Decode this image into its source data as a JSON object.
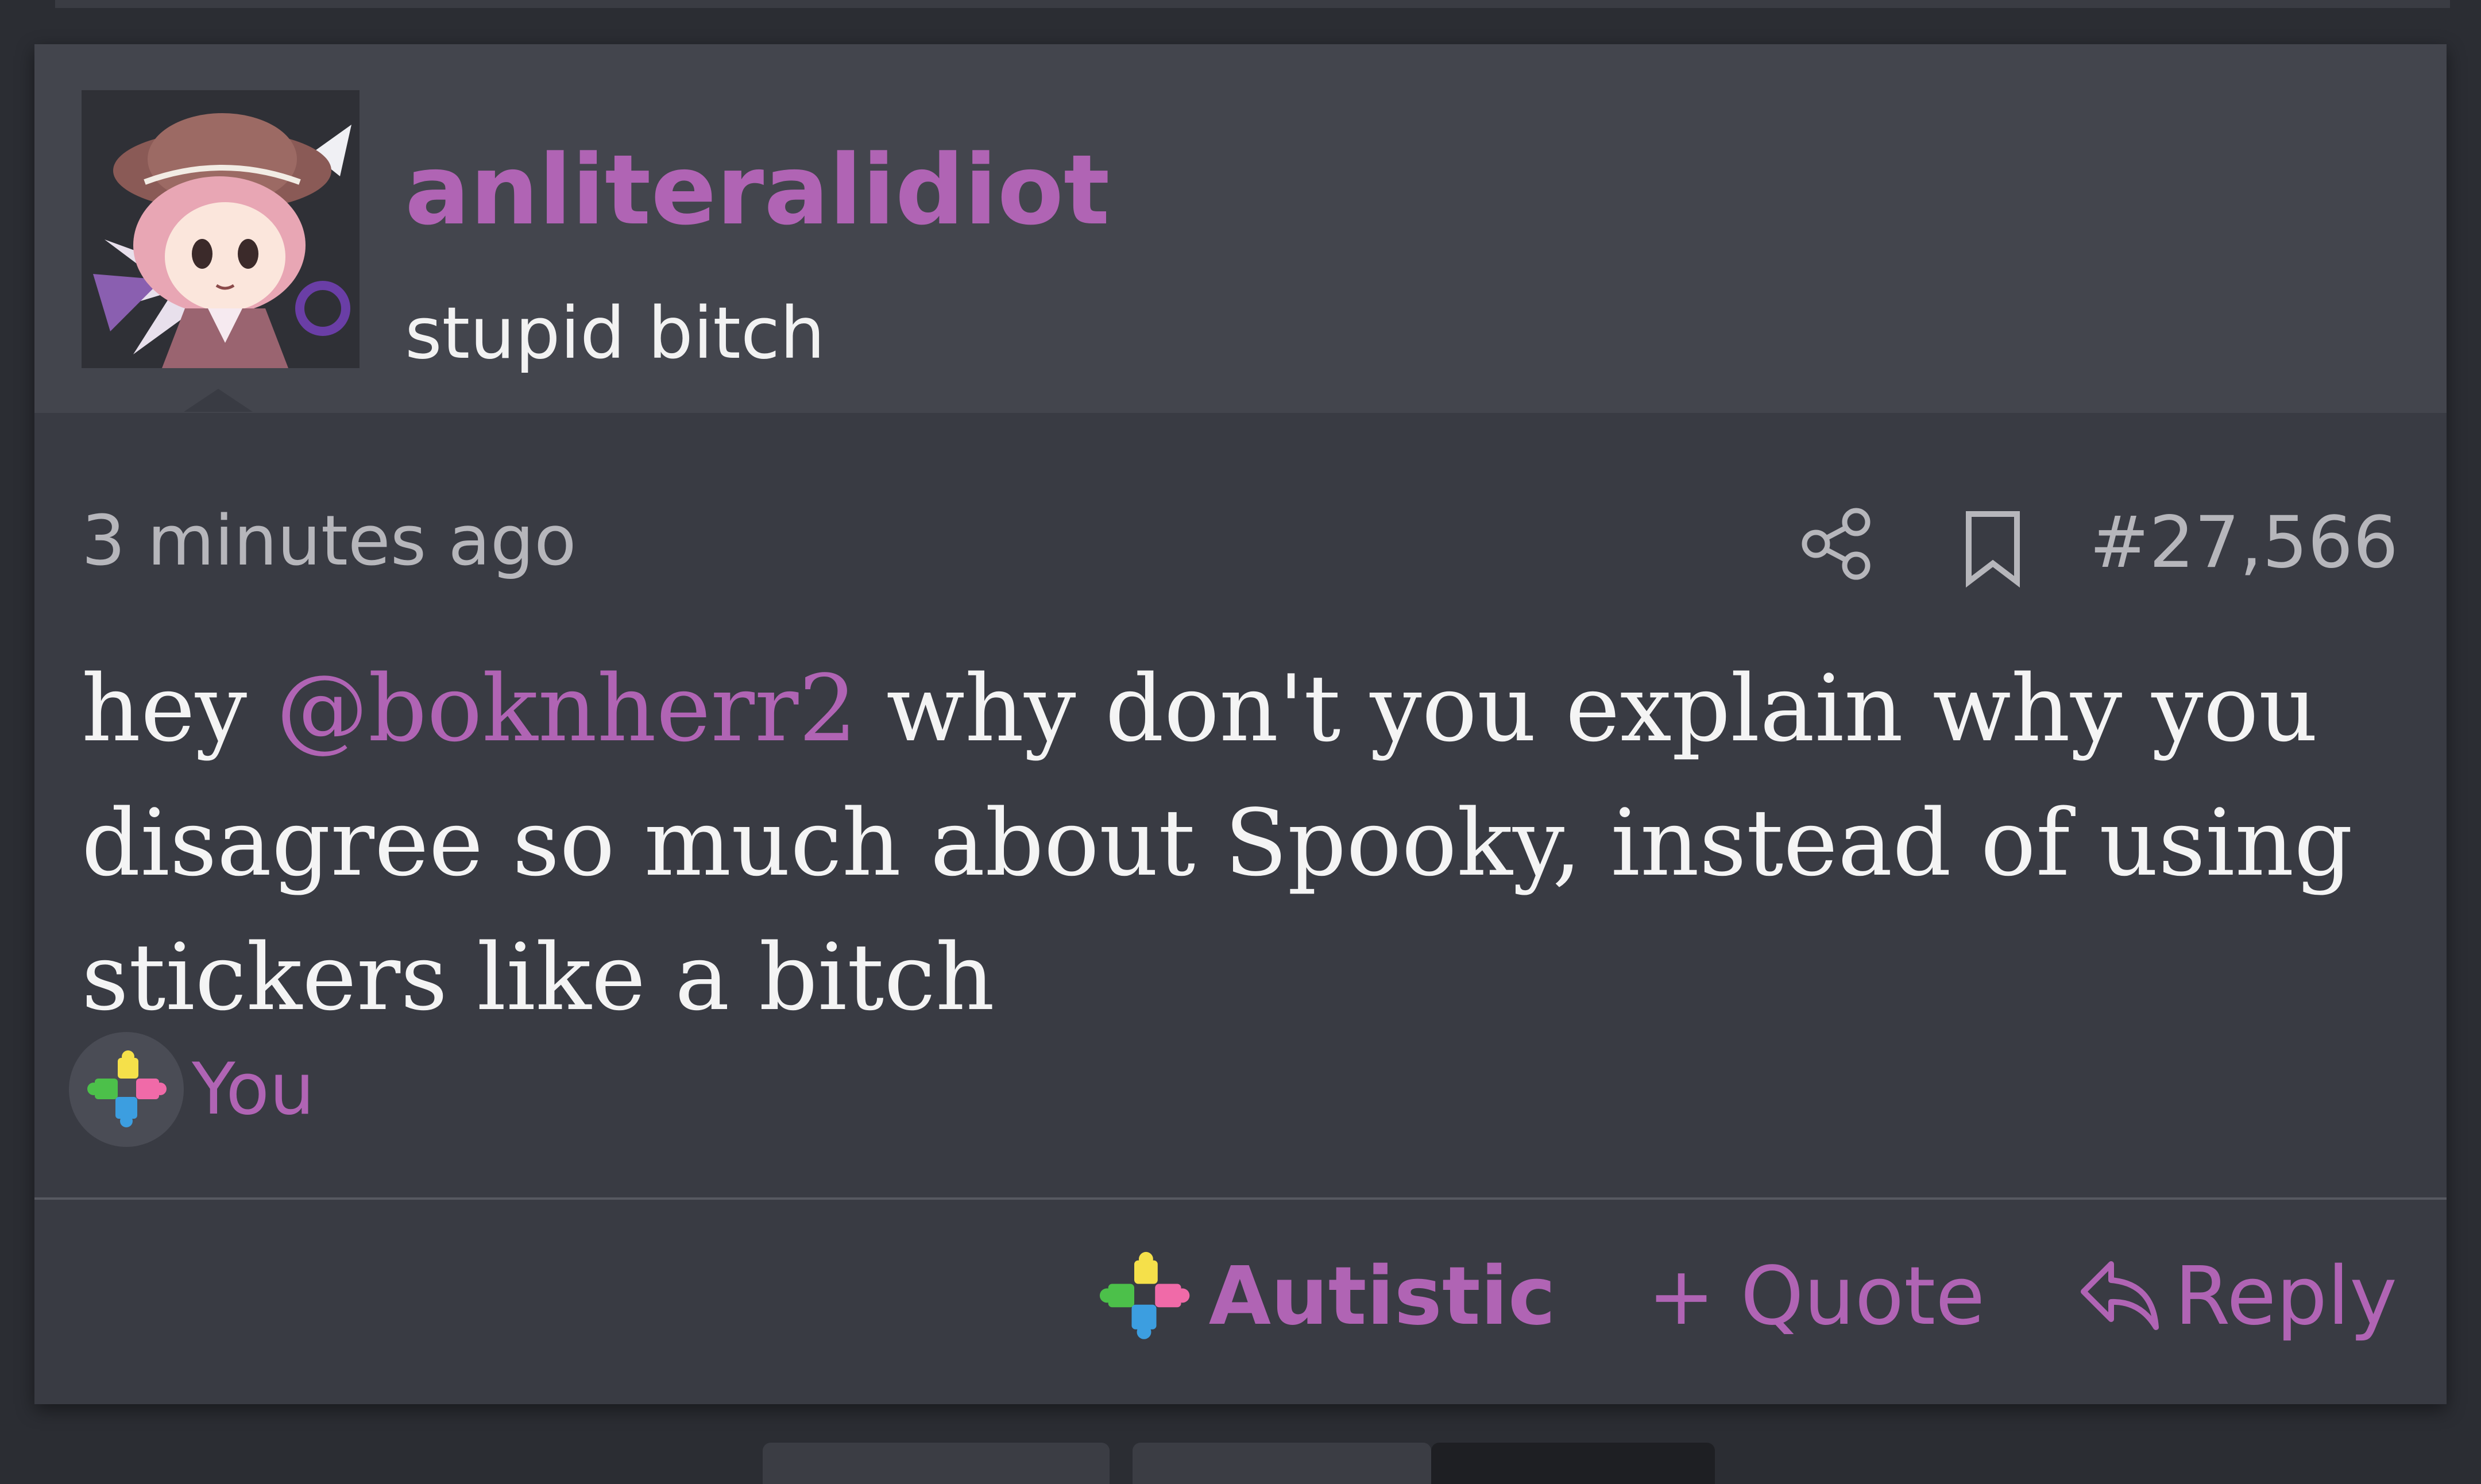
{
  "post": {
    "username": "anliteralidiot",
    "user_title": "stupid bitch",
    "timestamp": "3 minutes ago",
    "post_number": "#27,566",
    "body": {
      "prefix": "hey ",
      "mention": "@boknherr2",
      "suffix": " why don't you explain why you disagree so much about Spooky, instead of using stickers like a bitch"
    },
    "reaction_summary": {
      "icon": "puzzle-icon",
      "label": "You"
    }
  },
  "footer": {
    "react_label": "Autistic",
    "quote_label": "+ Quote",
    "reply_label": "Reply"
  },
  "icons": {
    "share": "share-icon",
    "bookmark": "bookmark-icon",
    "reply": "reply-icon",
    "reaction": "puzzle-icon"
  },
  "colors": {
    "accent": "#b064b4",
    "card_bg": "#393b43",
    "header_bg": "#43454d",
    "page_bg": "#2b2d33",
    "text_primary": "#f4f4f4",
    "text_muted": "#b6b6bb"
  }
}
